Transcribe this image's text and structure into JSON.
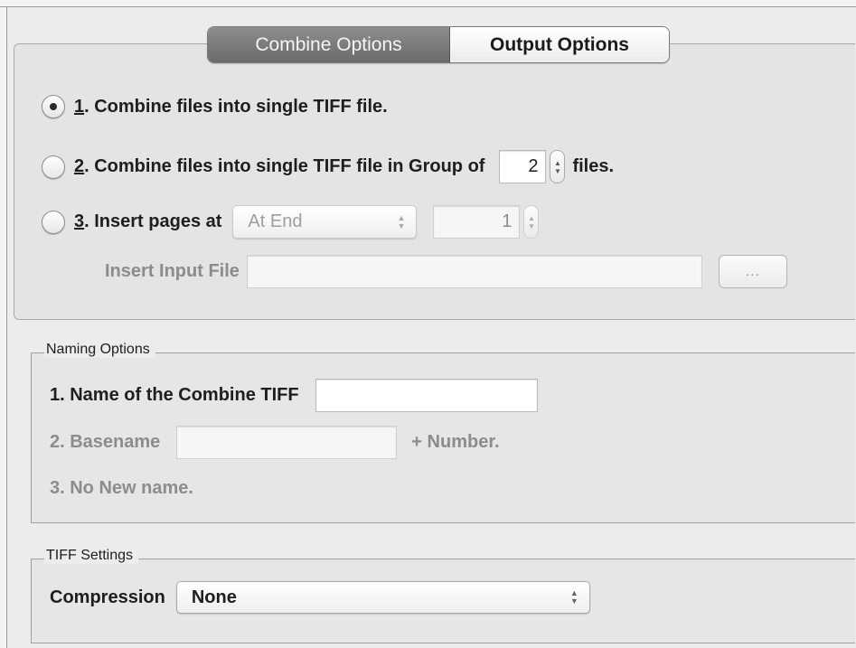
{
  "tabs": [
    {
      "label": "Combine Options",
      "selected": true
    },
    {
      "label": "Output Options",
      "selected": false
    }
  ],
  "combine": {
    "option1": {
      "num": "1",
      "text": ". Combine files into single TIFF file.",
      "selected": true
    },
    "option2": {
      "num": "2",
      "text_before": ". Combine files into single TIFF file in Group of",
      "group_value": "2",
      "text_after": "files.",
      "selected": false
    },
    "option3": {
      "num": "3",
      "text": ". Insert pages at",
      "position": "At End",
      "page_value": "1",
      "selected": false
    },
    "insert_input": {
      "label": "Insert Input File",
      "value": "",
      "browse_label": "..."
    }
  },
  "naming": {
    "title": "Naming Options",
    "item1": {
      "label": "1. Name of the Combine TIFF",
      "value": ""
    },
    "item2": {
      "label": "2. Basename",
      "value": "",
      "suffix": "+ Number."
    },
    "item3": {
      "label": "3. No New name."
    }
  },
  "tiff": {
    "title": "TIFF Settings",
    "compression_label": "Compression",
    "compression_value": "None"
  },
  "icons": {
    "stepper": "stepper-arrows-icon",
    "popup": "popup-arrows-icon"
  }
}
